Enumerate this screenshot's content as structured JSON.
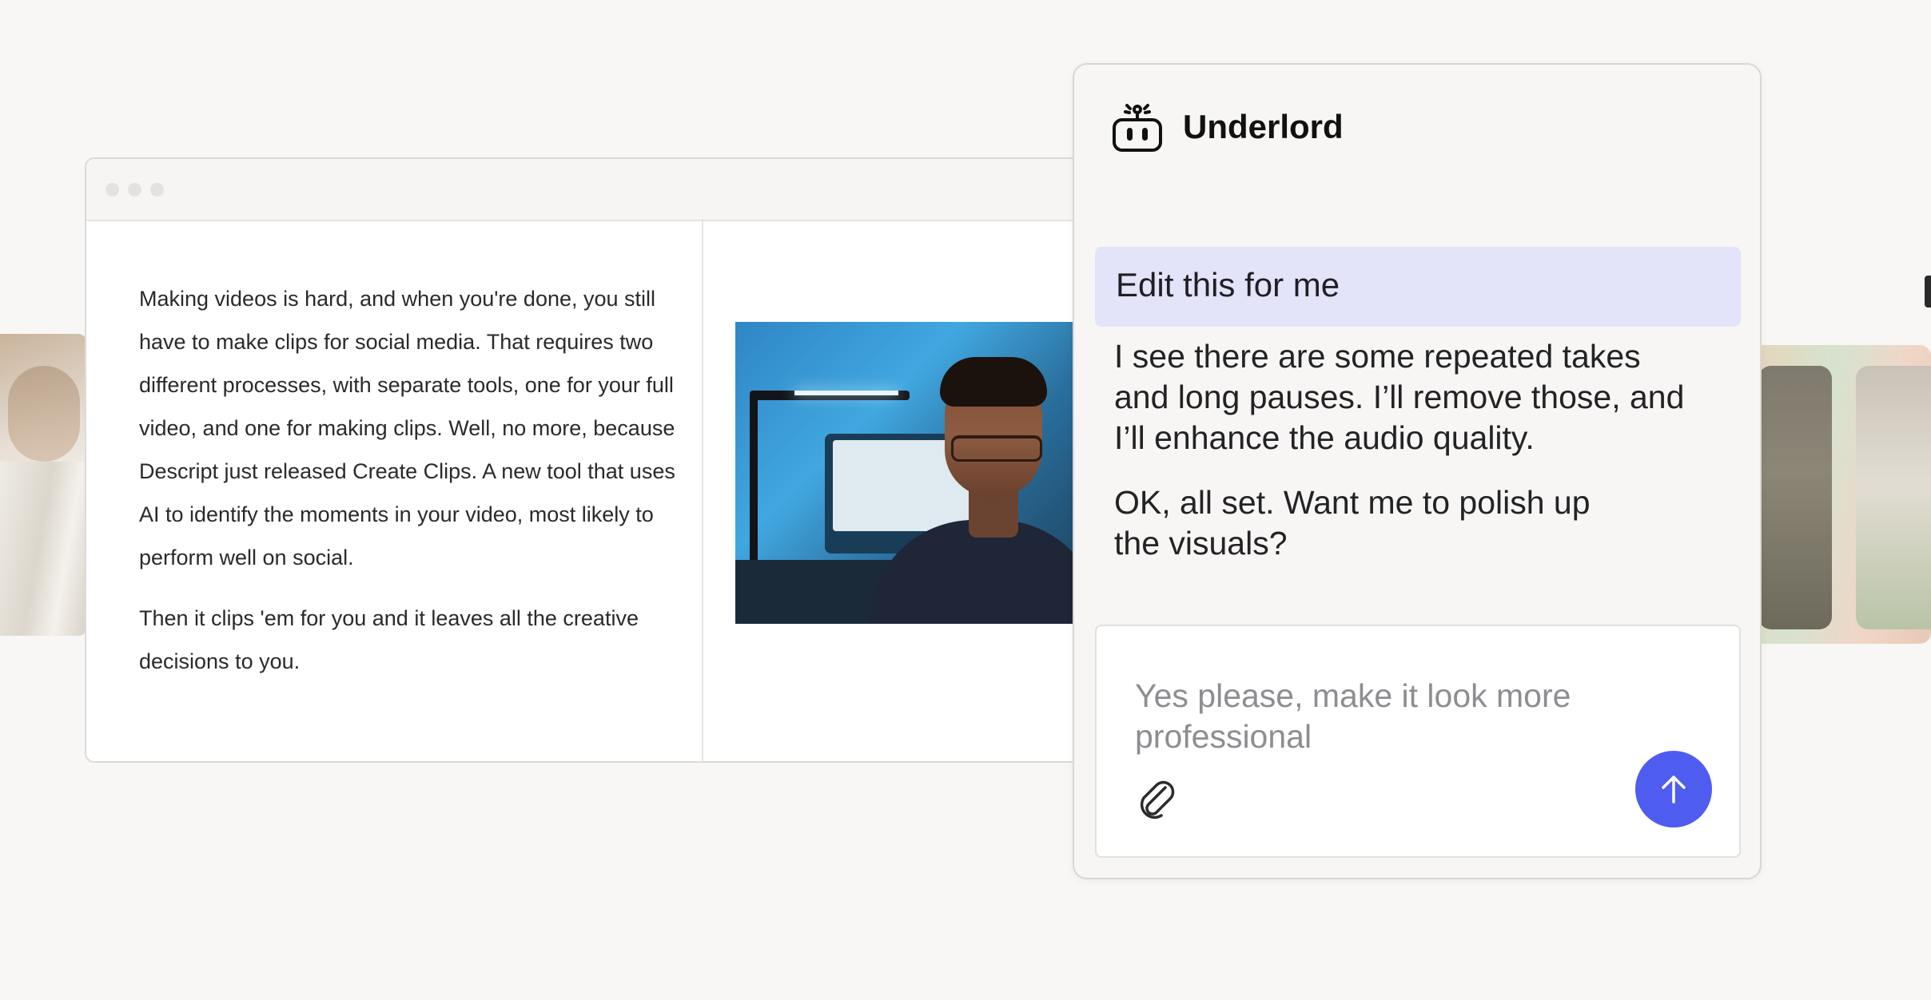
{
  "theme": {
    "accent": "#4f5cf0",
    "user_bubble": "#e3e3fa",
    "page_background": "#f8f7f5"
  },
  "editor": {
    "window_controls": [
      "close-dot",
      "minimize-dot",
      "zoom-dot"
    ],
    "transcript": {
      "paragraphs": [
        "Making videos is hard, and when you're done, you still have to make clips for social media. That requires two different processes, with separate tools, one for your full video, and one for making clips. Well, no more, because Descript just released Create Clips. A new tool that uses AI to identify the moments in your video, most likely to perform well on social.",
        "Then it clips 'em for you and it leaves all the creative decisions to you."
      ]
    }
  },
  "chat": {
    "title": "Underlord",
    "icon": "robot-icon",
    "messages": {
      "user": "Edit this for me",
      "assistant_1": "I see there are some repeated takes and long pauses. I’ll remove those, and I’ll enhance the audio quality.",
      "assistant_2": "OK, all set. Want me to polish up the visuals?"
    },
    "composer": {
      "value": "Yes please, make it look more professional",
      "attach_icon": "paperclip-icon",
      "send_icon": "arrow-up-icon"
    }
  }
}
